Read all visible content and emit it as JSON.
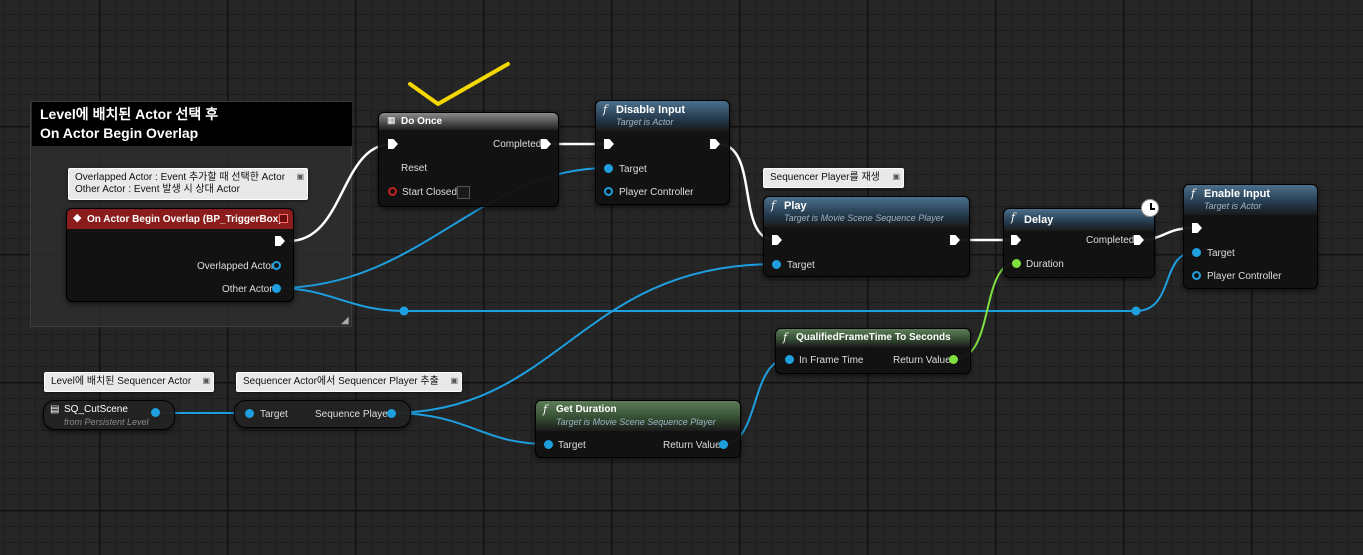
{
  "comment": {
    "title_line1": "Level에 배치된 Actor 선택 후",
    "title_line2": "On Actor Begin Overlap"
  },
  "bubbles": {
    "overlap_line1": "Overlapped Actor : Event 추가할 때 선택한 Actor",
    "overlap_line2": "Other Actor : Event 발생 시 상대 Actor",
    "sequencer_player": "Sequencer Player를 재생",
    "level_sequencer": "Level에 배치된 Sequencer Actor",
    "extract_player": "Sequencer Actor에서 Sequencer Player 추출"
  },
  "event_node": {
    "title": "On Actor Begin Overlap (BP_TriggerBox)",
    "pin_overlapped": "Overlapped Actor",
    "pin_other": "Other Actor"
  },
  "do_once": {
    "title": "Do Once",
    "pin_completed": "Completed",
    "pin_reset": "Reset",
    "pin_start_closed": "Start Closed"
  },
  "disable_input": {
    "title": "Disable Input",
    "subtitle": "Target is Actor",
    "pin_target": "Target",
    "pin_pc": "Player Controller"
  },
  "play": {
    "title": "Play",
    "subtitle": "Target is Movie Scene Sequence Player",
    "pin_target": "Target"
  },
  "delay": {
    "title": "Delay",
    "pin_completed": "Completed",
    "pin_duration": "Duration"
  },
  "enable_input": {
    "title": "Enable Input",
    "subtitle": "Target is Actor",
    "pin_target": "Target",
    "pin_pc": "Player Controller"
  },
  "qft": {
    "title": "QualifiedFrameTime To Seconds",
    "pin_in": "In Frame Time",
    "pin_ret": "Return Value"
  },
  "get_duration": {
    "title": "Get Duration",
    "subtitle": "Target is Movie Scene Sequence Player",
    "pin_target": "Target",
    "pin_ret": "Return Value"
  },
  "sq_var": {
    "name": "SQ_CutScene",
    "sub": "from Persistent Level"
  },
  "get_player": {
    "pin_target": "Target",
    "pin_out": "Sequence Player"
  },
  "colors": {
    "exec_wire": "#ffffff",
    "object_wire": "#1d9fe0",
    "float_wire": "#7fe040",
    "annotation_check": "#f5d800"
  }
}
